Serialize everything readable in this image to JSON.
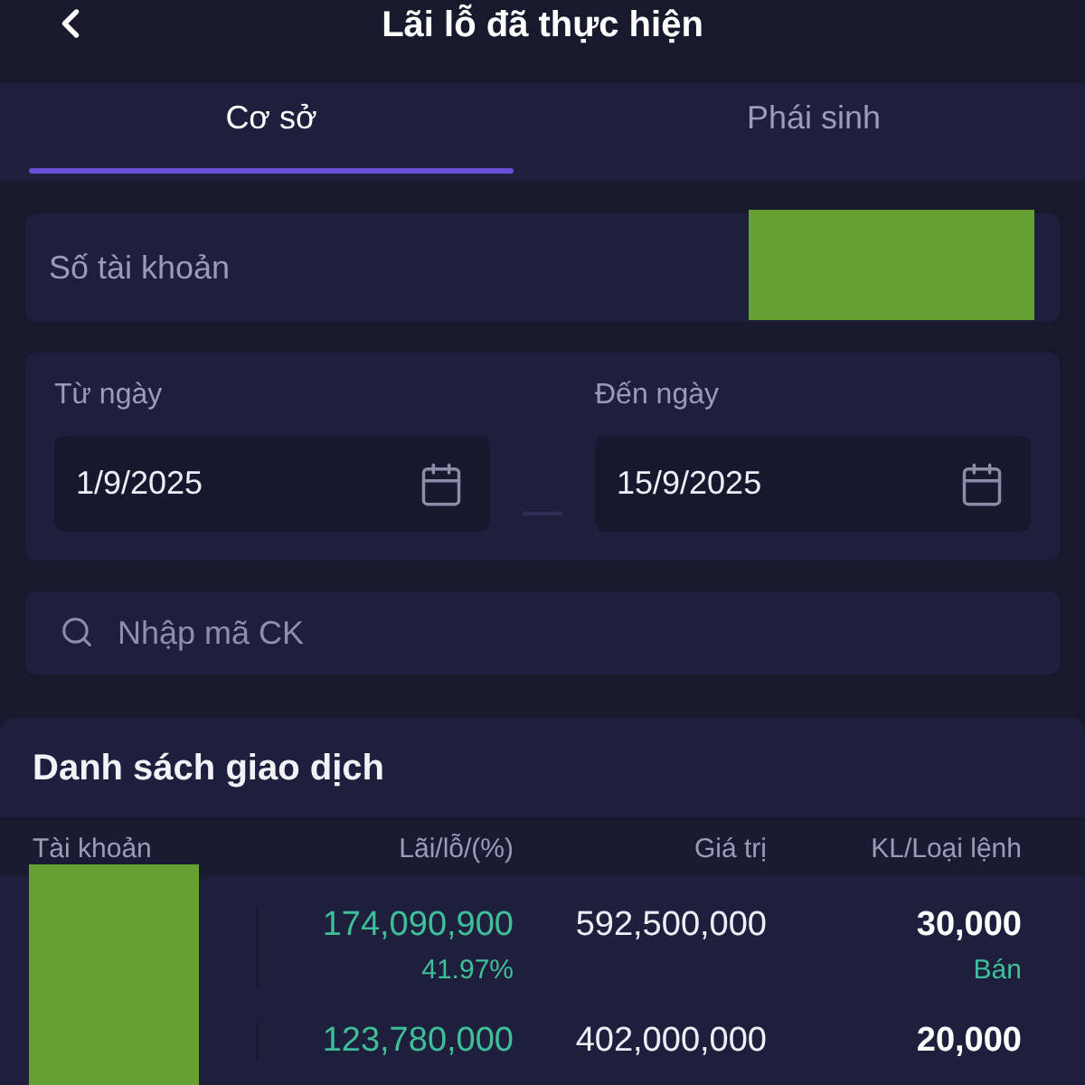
{
  "header": {
    "title": "Lãi lỗ đã thực hiện"
  },
  "tabs": [
    {
      "label": "Cơ sở",
      "selected": true
    },
    {
      "label": "Phái sinh",
      "selected": false
    }
  ],
  "account_field": {
    "label": "Số tài khoản"
  },
  "date_range": {
    "from": {
      "label": "Từ ngày",
      "value": "1/9/2025"
    },
    "to": {
      "label": "Đến ngày",
      "value": "15/9/2025"
    }
  },
  "search": {
    "placeholder": "Nhập mã CK"
  },
  "transactions": {
    "title": "Danh sách giao dịch",
    "columns": [
      "Tài khoản",
      "Lãi/lỗ/(%)",
      "Giá trị",
      "KL/Loại lệnh"
    ],
    "rows": [
      {
        "profit_loss": "174,090,900",
        "percent": "41.97%",
        "value": "592,500,000",
        "quantity": "30,000",
        "order_type": "Bán"
      },
      {
        "profit_loss": "123,780,000",
        "value": "402,000,000",
        "quantity": "20,000"
      }
    ]
  }
}
